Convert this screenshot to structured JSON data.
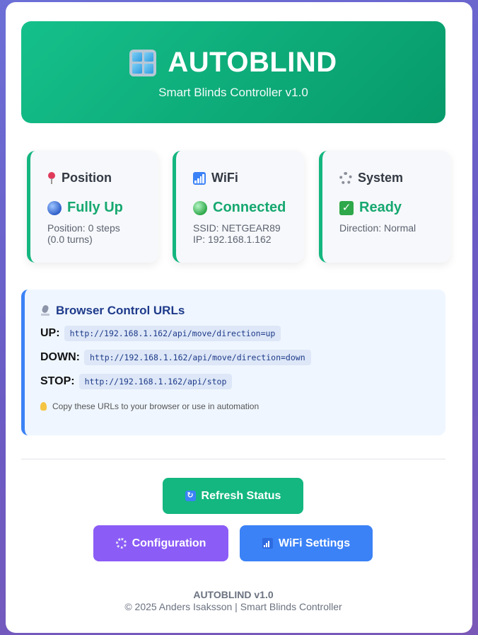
{
  "header": {
    "title": "AUTOBLIND",
    "subtitle": "Smart Blinds Controller v1.0",
    "icon": "window-icon"
  },
  "status": {
    "position": {
      "title": "Position",
      "icon": "pin-icon",
      "value": "Fully Up",
      "value_icon": "blue-circle-icon",
      "detail_line1": "Position: 0 steps",
      "detail_line2": "(0.0 turns)"
    },
    "wifi": {
      "title": "WiFi",
      "icon": "signal-icon",
      "value": "Connected",
      "value_icon": "green-circle-icon",
      "detail_line1": "SSID: NETGEAR89",
      "detail_line2": "IP: 192.168.1.162"
    },
    "system": {
      "title": "System",
      "icon": "gear-icon",
      "value": "Ready",
      "value_icon": "check-icon",
      "detail_line1": "Direction: Normal"
    }
  },
  "urls": {
    "title": "Browser Control URLs",
    "icon": "microphone-icon",
    "up_label": "UP:",
    "up_url": "http://192.168.1.162/api/move/direction=up",
    "down_label": "DOWN:",
    "down_url": "http://192.168.1.162/api/move/direction=down",
    "stop_label": "STOP:",
    "stop_url": "http://192.168.1.162/api/stop",
    "tip": "Copy these URLs to your browser or use in automation",
    "tip_icon": "bulb-icon"
  },
  "buttons": {
    "refresh": "Refresh Status",
    "configuration": "Configuration",
    "wifi_settings": "WiFi Settings"
  },
  "footer": {
    "title": "AUTOBLIND v1.0",
    "copyright": "© 2025 Anders Isaksson | Smart Blinds Controller"
  },
  "colors": {
    "accent_green": "#13b77f",
    "accent_purple": "#8b5cf6",
    "accent_blue": "#3b82f6",
    "background": "#6a5bc4"
  }
}
